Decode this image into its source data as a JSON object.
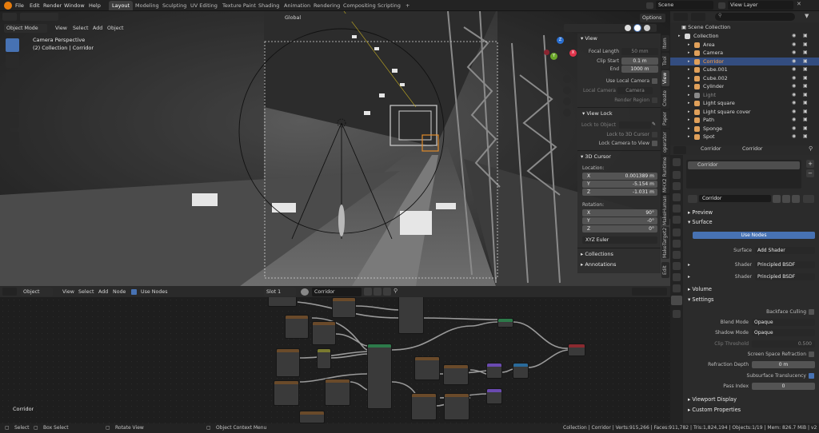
{
  "topbar": {
    "menus": [
      "File",
      "Edit",
      "Render",
      "Window",
      "Help"
    ],
    "workspaces": [
      "Layout",
      "Modeling",
      "Sculpting",
      "UV Editing",
      "Texture Paint",
      "Shading",
      "Animation",
      "Rendering",
      "Compositing",
      "Scripting"
    ],
    "active_workspace": "Layout",
    "add_tab": "+",
    "scene": "Scene",
    "view_layer": "View Layer"
  },
  "viewport": {
    "mode": "Object Mode",
    "menus": [
      "View",
      "Select",
      "Add",
      "Object"
    ],
    "transform_orientation": "Global",
    "options_label": "Options",
    "overlay_line1": "Camera Perspective",
    "overlay_line2": "(2) Collection | Corridor",
    "tabs": [
      "Item",
      "Tool",
      "View",
      "Create",
      "Paper",
      "operator",
      "MHX2 Runtime",
      "MakeHuman",
      "MakeTarget2",
      "Edit"
    ],
    "active_tab": "View",
    "gizmo": {
      "z": "Z",
      "x": "X",
      "y": "Y"
    }
  },
  "view_panel": {
    "title": "View",
    "focal_length_label": "Focal Length",
    "focal_length": "50 mm",
    "clip_start_label": "Clip Start",
    "clip_start": "0.1 m",
    "end_label": "End",
    "end": "1000 m",
    "use_local_camera": "Use Local Camera",
    "local_camera_label": "Local Camera",
    "local_camera_value": "Camera",
    "render_region": "Render Region",
    "view_lock_title": "View Lock",
    "lock_to_object": "Lock to Object",
    "lock_to_3d_cursor": "Lock to 3D Cursor",
    "lock_camera_to_view": "Lock Camera to View",
    "cursor_title": "3D Cursor",
    "location_label": "Location:",
    "loc_x": "0.001389 m",
    "loc_y": "-5.154 m",
    "loc_z": "-1.031 m",
    "rotation_label": "Rotation:",
    "rot_x": "90°",
    "rot_y": "-0°",
    "rot_z": "0°",
    "rotation_mode": "XYZ Euler",
    "collections": "Collections",
    "annotations": "Annotations",
    "axis_x": "X",
    "axis_y": "Y",
    "axis_z": "Z"
  },
  "node_editor": {
    "type_label": "Object",
    "menus": [
      "View",
      "Select",
      "Add",
      "Node"
    ],
    "use_nodes": "Use Nodes",
    "slot": "Slot 1",
    "material": "Corridor",
    "frame_label": "Corridor"
  },
  "outliner": {
    "root": "Scene Collection",
    "items": [
      {
        "name": "Collection",
        "color": "#d8d8d8"
      },
      {
        "name": "Area",
        "color": "#e0a05a"
      },
      {
        "name": "Camera",
        "color": "#e0a05a"
      },
      {
        "name": "Corridor",
        "color": "#e0a05a"
      },
      {
        "name": "Cube.001",
        "color": "#e0a05a"
      },
      {
        "name": "Cube.002",
        "color": "#e0a05a"
      },
      {
        "name": "Cylinder",
        "color": "#e0a05a"
      },
      {
        "name": "Light",
        "color": "#8a8a8a"
      },
      {
        "name": "Light square",
        "color": "#e0a05a"
      },
      {
        "name": "Light square cover",
        "color": "#e0a05a"
      },
      {
        "name": "Path",
        "color": "#e0a05a"
      },
      {
        "name": "Sponge",
        "color": "#e0a05a"
      },
      {
        "name": "Spot",
        "color": "#e0a05a"
      }
    ]
  },
  "properties": {
    "breadcrumb_object": "Corridor",
    "breadcrumb_material": "Corridor",
    "slot_name": "Corridor",
    "material_name": "Corridor",
    "preview": "Preview",
    "surface_section": "Surface",
    "use_nodes_btn": "Use Nodes",
    "surface_label": "Surface",
    "surface_value": "Add Shader",
    "shader_label": "Shader",
    "shader1": "Principled BSDF",
    "shader2": "Principled BSDF",
    "volume": "Volume",
    "settings": "Settings",
    "backface": "Backface Culling",
    "blend_mode_label": "Blend Mode",
    "blend_mode": "Opaque",
    "shadow_mode_label": "Shadow Mode",
    "shadow_mode": "Opaque",
    "clip_threshold_label": "Clip Threshold",
    "clip_threshold": "0.500",
    "ssr": "Screen Space Refraction",
    "refraction_depth_label": "Refraction Depth",
    "refraction_depth": "0 m",
    "subsurface": "Subsurface Translucency",
    "pass_index_label": "Pass Index",
    "pass_index": "0",
    "viewport_display": "Viewport Display",
    "custom_properties": "Custom Properties"
  },
  "status": {
    "select": "Select",
    "box_select": "Box Select",
    "rotate_view": "Rotate View",
    "context_menu": "Object Context Menu",
    "stats": "Collection | Corridor | Verts:915,266 | Faces:911,782 | Tris:1,824,194 | Objects:1/19 | Mem: 826.7 MiB | v2.82.7"
  },
  "colors": {
    "accent": "#4772b3",
    "selection": "#334d80",
    "header": "#232323"
  }
}
